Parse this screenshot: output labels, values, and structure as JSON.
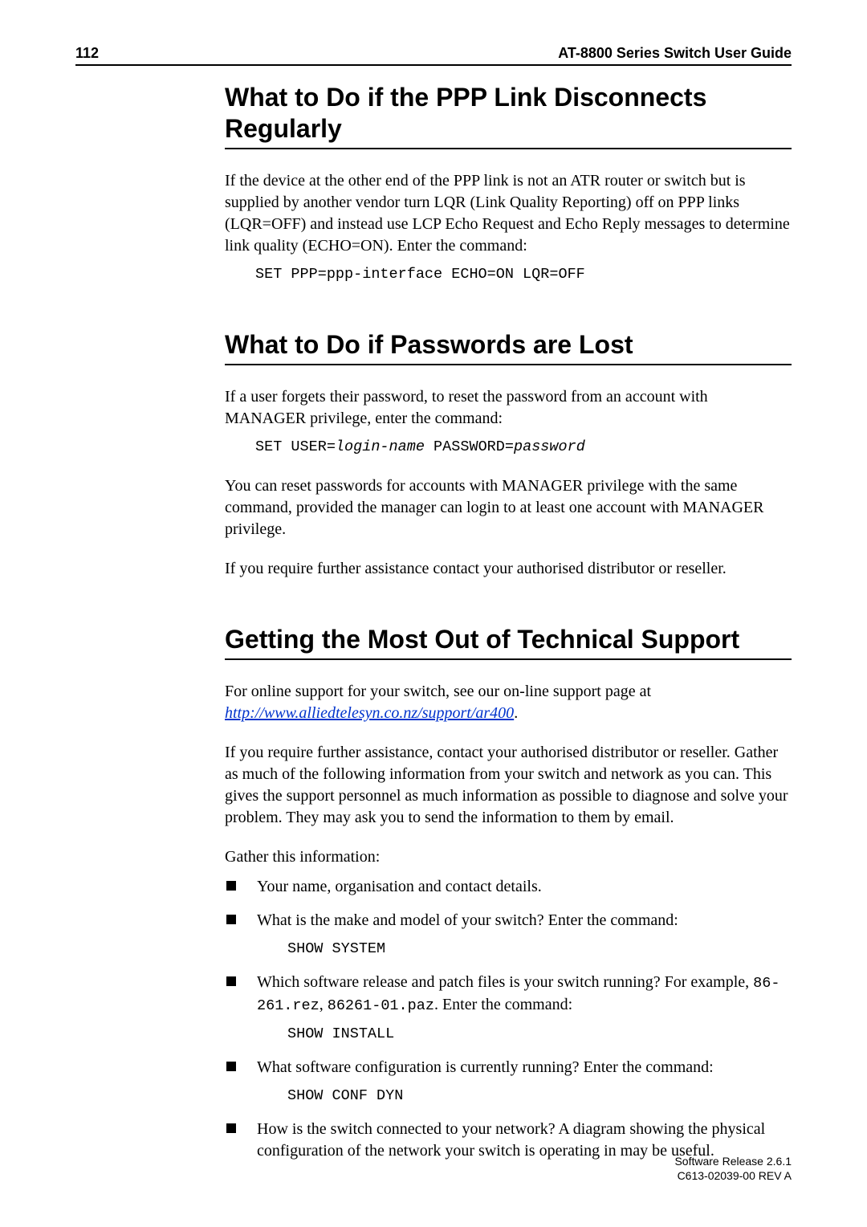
{
  "header": {
    "page_number": "112",
    "doc_title": "AT-8800 Series Switch User Guide"
  },
  "sections": [
    {
      "heading": "What to Do if the PPP Link Disconnects Regularly",
      "para1": "If the device at the other end of the PPP link is not an ATR router or switch but is supplied by another vendor turn LQR (Link Quality Reporting) off on PPP links (LQR=OFF) and instead use LCP Echo Request and Echo Reply messages to determine link quality (ECHO=ON). Enter the command:",
      "cmd1": "SET PPP=ppp-interface ECHO=ON LQR=OFF"
    },
    {
      "heading": "What to Do if Passwords are Lost",
      "para1": "If a user forgets their password, to reset the password from an account with MANAGER privilege, enter the command:",
      "cmd1_prefix": "SET USER=",
      "cmd1_arg1": "login-name",
      "cmd1_mid": " PASSWORD=",
      "cmd1_arg2": "password",
      "para2": "You can reset passwords for accounts with MANAGER privilege with the same command, provided the manager can login to at least one account with MANAGER privilege.",
      "para3": "If you require further assistance contact your authorised distributor or reseller."
    },
    {
      "heading": "Getting the Most Out of Technical Support",
      "para1_pre": "For online support for your switch, see our on-line support page at ",
      "link_text": "http://www.alliedtelesyn.co.nz/support/ar400",
      "para1_post": ".",
      "para2": "If you require further assistance, contact your authorised distributor or reseller. Gather as much of the following information from your switch and network as you can. This gives the support personnel as much information as possible to diagnose and solve your problem. They may ask you to send the information to them by email.",
      "para3": "Gather this information:",
      "bullets": [
        {
          "text": "Your name, organisation and contact details."
        },
        {
          "text": "What is the make and model of your switch? Enter the command:",
          "cmd": "SHOW SYSTEM"
        },
        {
          "text_pre": "Which software release and patch files is your switch running? For example, ",
          "code1": "86-261.rez",
          "text_mid": ", ",
          "code2": "86261-01.paz",
          "text_post": ". Enter the command:",
          "cmd": "SHOW INSTALL"
        },
        {
          "text": "What software configuration is currently running? Enter the command:",
          "cmd": "SHOW CONF DYN"
        },
        {
          "text": "How is the switch connected to your network? A diagram showing the physical configuration of the network your switch is operating in may be useful."
        }
      ]
    }
  ],
  "footer": {
    "line1": "Software Release 2.6.1",
    "line2": "C613-02039-00 REV A"
  }
}
